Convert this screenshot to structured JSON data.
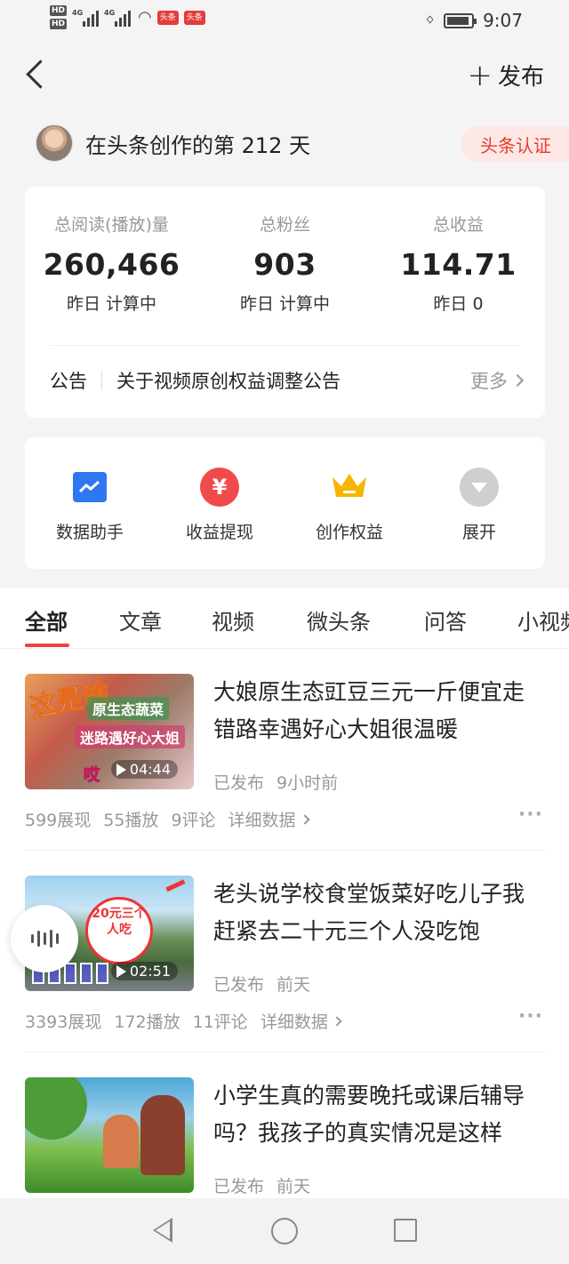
{
  "status_bar": {
    "time": "9:07",
    "hd1": "HD",
    "hd2": "HD",
    "net1": "4G",
    "net2": "4G",
    "app_badge1": "头条",
    "app_badge2": "头条"
  },
  "header": {
    "back_icon": "back-arrow-icon",
    "publish_label": "发布",
    "publish_icon": "plus-icon"
  },
  "profile": {
    "text": "在头条创作的第 212 天",
    "verify_label": "头条认证"
  },
  "stats": [
    {
      "label": "总阅读(播放)量",
      "value": "260,466",
      "sub": "昨日 计算中"
    },
    {
      "label": "总粉丝",
      "value": "903",
      "sub": "昨日 计算中"
    },
    {
      "label": "总收益",
      "value": "114.71",
      "sub": "昨日 0"
    }
  ],
  "notice": {
    "tag": "公告",
    "text": "关于视频原创权益调整公告",
    "more": "更多"
  },
  "tools": [
    {
      "label": "数据助手",
      "icon": "chart-icon"
    },
    {
      "label": "收益提现",
      "icon": "yuan-icon"
    },
    {
      "label": "创作权益",
      "icon": "crown-icon"
    },
    {
      "label": "展开",
      "icon": "expand-icon"
    }
  ],
  "tabs": [
    "全部",
    "文章",
    "视频",
    "微头条",
    "问答",
    "小视频"
  ],
  "posts": [
    {
      "title": "大娘原生态豇豆三元一斤便宜走错路幸遇好心大姐很温暖",
      "duration": "04:44",
      "status": "已发布",
      "time": "9小时前",
      "views": "599展现",
      "plays": "55播放",
      "comments": "9评论",
      "detail": "详细数据",
      "thumb_text_big": "这是啥",
      "thumb_cap1": "原生态蔬菜",
      "thumb_cap2": "迷路遇好心大姐",
      "thumb_cap3": "哎"
    },
    {
      "title": "老头说学校食堂饭菜好吃儿子我赶紧去二十元三个人没吃饱",
      "duration": "02:51",
      "status": "已发布",
      "time": "前天",
      "views": "3393展现",
      "plays": "172播放",
      "comments": "11评论",
      "detail": "详细数据",
      "thumb_circle_text": "20元三个人吃"
    },
    {
      "title": "小学生真的需要晚托或课后辅导吗？我孩子的真实情况是这样",
      "status": "已发布",
      "time": "前天"
    }
  ],
  "nav": {
    "back_icon": "nav-back-icon",
    "home_icon": "nav-home-icon",
    "recent_icon": "nav-recent-icon"
  },
  "colors": {
    "accent": "#f04142",
    "verify_bg": "#fde8e6",
    "page_bg": "#f4f4f4"
  }
}
